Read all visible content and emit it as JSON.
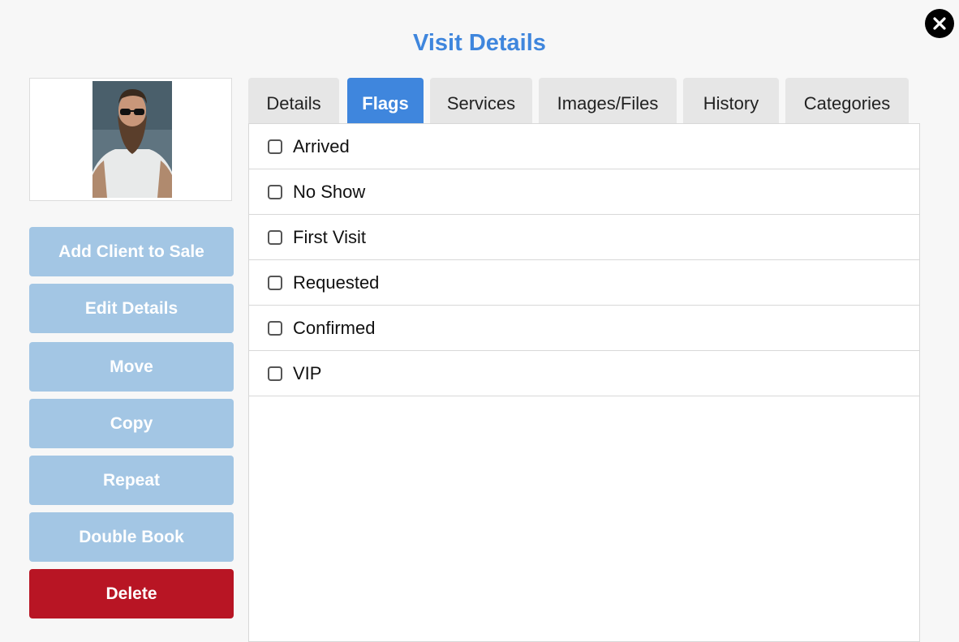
{
  "dialog": {
    "title": "Visit Details",
    "close_icon": "close-icon"
  },
  "sidebar": {
    "photo_alt": "client-photo",
    "buttons": [
      {
        "label": "Add Client to Sale"
      },
      {
        "label": "Edit Details"
      },
      {
        "label": "Move"
      },
      {
        "label": "Copy"
      },
      {
        "label": "Repeat"
      },
      {
        "label": "Double Book"
      },
      {
        "label": "Delete"
      }
    ]
  },
  "tabs": [
    {
      "label": "Details",
      "active": false
    },
    {
      "label": "Flags",
      "active": true
    },
    {
      "label": "Services",
      "active": false
    },
    {
      "label": "Images/Files",
      "active": false
    },
    {
      "label": "History",
      "active": false
    },
    {
      "label": "Categories",
      "active": false
    }
  ],
  "flags": [
    {
      "label": "Arrived",
      "checked": false
    },
    {
      "label": "No Show",
      "checked": false
    },
    {
      "label": "First Visit",
      "checked": false
    },
    {
      "label": "Requested",
      "checked": false
    },
    {
      "label": "Confirmed",
      "checked": false
    },
    {
      "label": "VIP",
      "checked": false
    }
  ],
  "colors": {
    "accent": "#3f86dd",
    "button_light": "#a3c6e4",
    "danger": "#b81524"
  }
}
